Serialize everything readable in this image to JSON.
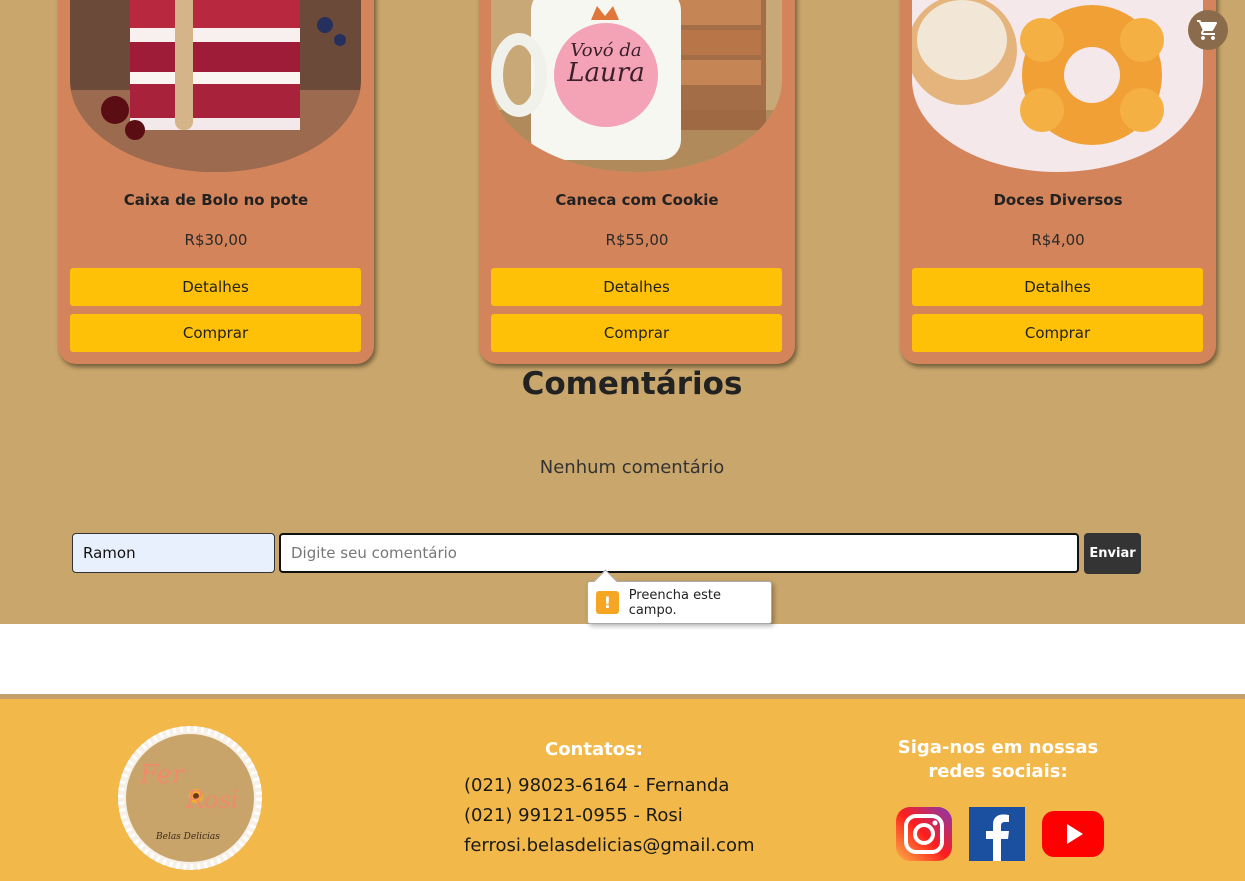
{
  "products": [
    {
      "name": "Caixa de Bolo no pote",
      "price": "R$30,00",
      "details_label": "Detalhes",
      "buy_label": "Comprar"
    },
    {
      "name": "Caneca com Cookie",
      "price": "R$55,00",
      "details_label": "Detalhes",
      "buy_label": "Comprar",
      "mug_text_line1": "Vovó da",
      "mug_text_line2": "Laura"
    },
    {
      "name": "Doces Diversos",
      "price": "R$4,00",
      "details_label": "Detalhes",
      "buy_label": "Comprar"
    }
  ],
  "cart": {
    "icon": "shopping-cart-icon"
  },
  "comments": {
    "title": "Comentários",
    "empty_text": "Nenhum comentário",
    "name_value": "Ramon",
    "comment_placeholder": "Digite seu comentário",
    "comment_value": "",
    "send_label": "Enviar",
    "validation_message": "Preencha este campo."
  },
  "footer": {
    "logo_text_1": "Fer",
    "logo_text_2": "Rosi",
    "logo_text_3": "Belas Delicias",
    "contacts_title": "Contatos:",
    "contacts": [
      "(021) 98023-6164 - Fernanda",
      "(021) 99121-0955 - Rosi",
      "ferrosi.belasdelicias@gmail.com"
    ],
    "social_title_line1": "Siga-nos em nossas",
    "social_title_line2": "redes sociais:",
    "social_icons": [
      "instagram-icon",
      "facebook-icon",
      "youtube-icon"
    ]
  },
  "colors": {
    "page_bg": "#c9a66b",
    "card_bg": "#d4845a",
    "button_yellow": "#ffc107",
    "footer_bg": "#f2b84a",
    "send_button": "#343434"
  }
}
